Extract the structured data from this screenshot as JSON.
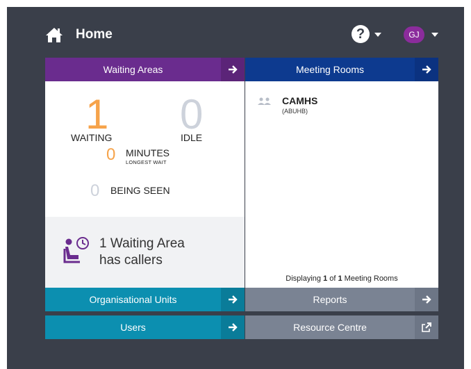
{
  "header": {
    "title": "Home",
    "help_icon": "question-circle-icon",
    "help_glyph": "?",
    "avatar_initials": "GJ",
    "avatar_color": "#8b2c9c"
  },
  "waiting_areas": {
    "title": "Waiting Areas",
    "waiting_count": "1",
    "waiting_label": "WAITING",
    "idle_count": "0",
    "idle_label": "IDLE",
    "minutes_value": "0",
    "minutes_label": "MINUTES",
    "minutes_sub_label": "LONGEST WAIT",
    "being_seen_count": "0",
    "being_seen_label": "BEING SEEN",
    "callers_line1": "1 Waiting Area",
    "callers_line2": "has callers",
    "accent_color": "#6a2c8e"
  },
  "meeting_rooms": {
    "title": "Meeting Rooms",
    "rooms": [
      {
        "name": "CAMHS",
        "subtitle": "(ABUHB)"
      }
    ],
    "footer_prefix": "Displaying ",
    "footer_shown": "1",
    "footer_of": " of ",
    "footer_total": "1",
    "footer_suffix": " Meeting Rooms",
    "accent_color": "#0d3a8f"
  },
  "buttons": {
    "organisational_units": "Organisational Units",
    "users": "Users",
    "reports": "Reports",
    "resource_centre": "Resource Centre"
  },
  "colors": {
    "background": "#3a3f4a",
    "waiting_orange": "#f6a34a",
    "idle_grey": "#cdd2db",
    "teal": "#0c8fb0",
    "slate": "#7a8393"
  }
}
